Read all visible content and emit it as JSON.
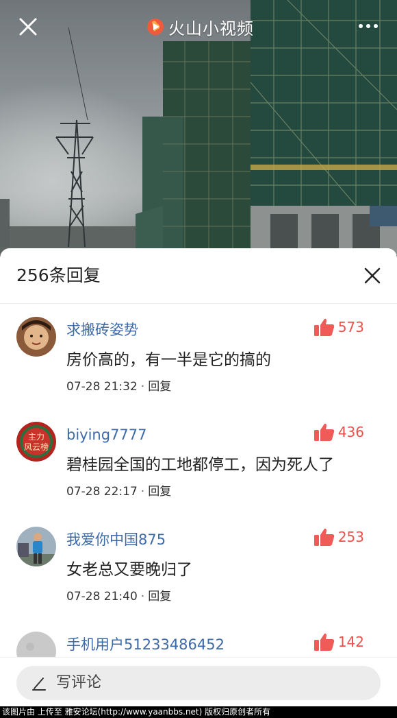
{
  "app": {
    "brand_name": "火山小视频",
    "brand_color": "#f05a3c"
  },
  "video": {
    "close_icon": "close-icon",
    "more_icon": "more-dots-icon"
  },
  "comments_panel": {
    "title": "256条回复",
    "close_icon": "close-icon",
    "like_color": "#f05a57",
    "username_color": "#3d6aa8",
    "comments": [
      {
        "username": "求搬砖姿势",
        "likes": "573",
        "text": "房价高的，有一半是它的搞的",
        "time": "07-28 21:32",
        "separator": "·",
        "reply_label": "回复"
      },
      {
        "username": "biying7777",
        "likes": "436",
        "text": "碧桂园全国的工地都停工，因为死人了",
        "time": "07-28 22:17",
        "separator": "·",
        "reply_label": "回复"
      },
      {
        "username": "我爱你中国875",
        "likes": "253",
        "text": "女老总又要晚归了",
        "time": "07-28 21:40",
        "separator": "·",
        "reply_label": "回复"
      },
      {
        "username": "手机用户51233486452",
        "likes": "142",
        "text": "",
        "time": "",
        "separator": "",
        "reply_label": ""
      }
    ]
  },
  "composer": {
    "label": "写评论",
    "icon": "pen-icon"
  },
  "watermark": {
    "text": "该图片由 上传至 雅安论坛(http://www.yaanbbs.net) 版权归原创者所有"
  }
}
